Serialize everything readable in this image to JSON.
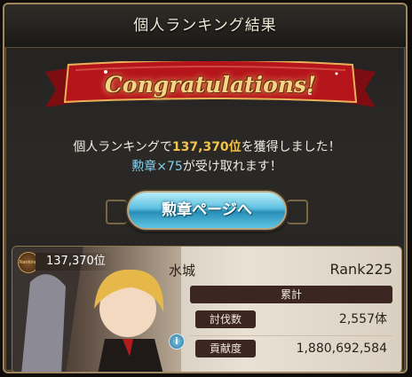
{
  "title": "個人ランキング結果",
  "banner": "Congratulations!",
  "message": {
    "line1_prefix": "個人ランキングで",
    "line1_rank": "137,370位",
    "line1_suffix": "を獲得しました！",
    "line2_medal": "勲章×75",
    "line2_suffix": "が受け取れます！"
  },
  "button": {
    "label": "勲章ページへ"
  },
  "card": {
    "badge": "Ranking",
    "rank_position": "137,370位",
    "name": "水城",
    "player_rank": "Rank225",
    "stats_header": "累計",
    "stats": [
      {
        "label": "討伐数",
        "value": "2,557体"
      },
      {
        "label": "貢献度",
        "value": "1,880,692,584"
      }
    ],
    "info_icon": "i"
  },
  "colors": {
    "accent_gold": "#f2c44b",
    "accent_blue": "#7fd2f0",
    "ribbon_red": "#b5141a"
  }
}
